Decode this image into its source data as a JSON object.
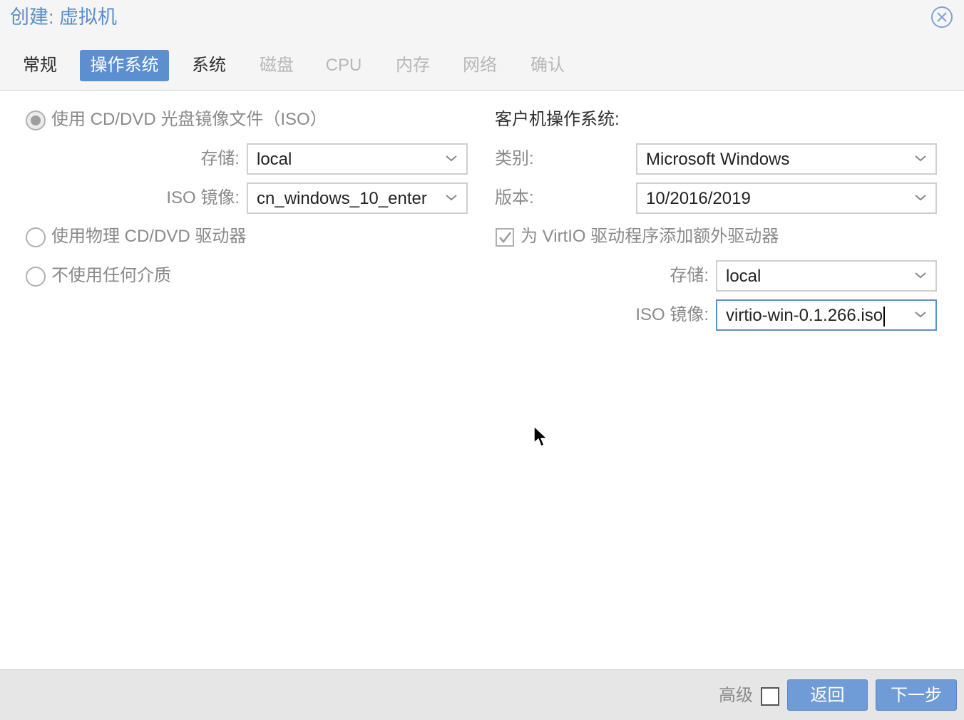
{
  "window": {
    "title": "创建: 虚拟机"
  },
  "tabs": [
    {
      "label": "常规",
      "state": "normal"
    },
    {
      "label": "操作系统",
      "state": "active"
    },
    {
      "label": "系统",
      "state": "normal"
    },
    {
      "label": "磁盘",
      "state": "disabled"
    },
    {
      "label": "CPU",
      "state": "disabled"
    },
    {
      "label": "内存",
      "state": "disabled"
    },
    {
      "label": "网络",
      "state": "disabled"
    },
    {
      "label": "确认",
      "state": "disabled"
    }
  ],
  "media": {
    "iso_option": "使用 CD/DVD 光盘镜像文件（ISO）",
    "storage_label": "存储:",
    "storage_value": "local",
    "iso_label": "ISO 镜像:",
    "iso_value": "cn_windows_10_enter",
    "physical_option": "使用物理 CD/DVD 驱动器",
    "none_option": "不使用任何介质"
  },
  "guest_os": {
    "header": "客户机操作系统:",
    "type_label": "类别:",
    "type_value": "Microsoft Windows",
    "version_label": "版本:",
    "version_value": "10/2016/2019",
    "virtio_checkbox_label": "为 VirtIO 驱动程序添加额外驱动器",
    "virtio_storage_label": "存储:",
    "virtio_storage_value": "local",
    "virtio_iso_label": "ISO 镜像:",
    "virtio_iso_value": "virtio-win-0.1.266.iso"
  },
  "footer": {
    "advanced_label": "高级",
    "back_label": "返回",
    "next_label": "下一步"
  },
  "colors": {
    "accent": "#5b8fd0",
    "title": "#5b8ec7"
  }
}
